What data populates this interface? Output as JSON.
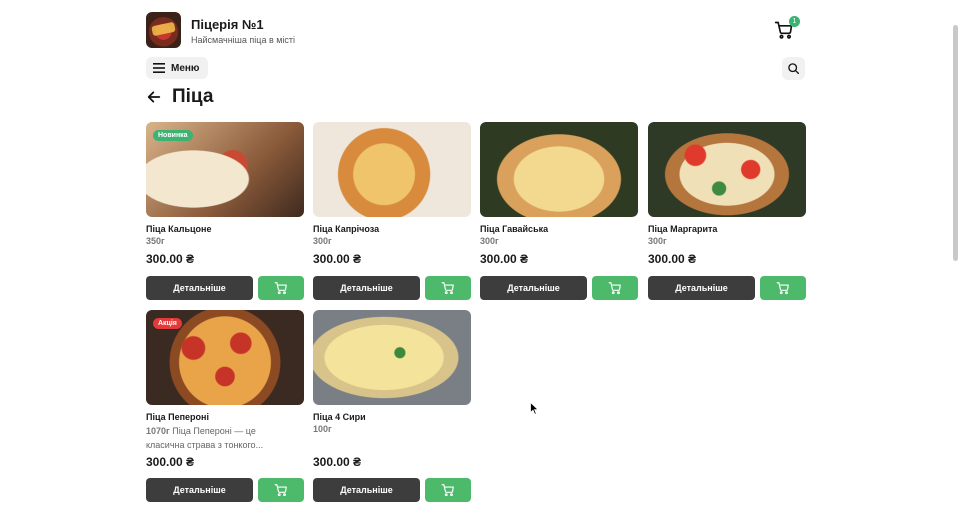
{
  "header": {
    "title": "Піцерія №1",
    "subtitle": "Найсмачніша піца в місті",
    "cart_count": "1"
  },
  "toolbar": {
    "menu_label": "Меню"
  },
  "page": {
    "title": "Піца"
  },
  "products": [
    {
      "name": "Піца Кальцоне",
      "weight": "350г",
      "desc": "",
      "price": "300.00 ₴",
      "badge": "Новинка",
      "badge_color": "#3cb371",
      "details_label": "Детальніше"
    },
    {
      "name": "Піца Капрічоза",
      "weight": "300г",
      "desc": "",
      "price": "300.00 ₴",
      "badge": "",
      "badge_color": "",
      "details_label": "Детальніше"
    },
    {
      "name": "Піца Гавайська",
      "weight": "300г",
      "desc": "",
      "price": "300.00 ₴",
      "badge": "",
      "badge_color": "",
      "details_label": "Детальніше"
    },
    {
      "name": "Піца Маргарита",
      "weight": "300г",
      "desc": "",
      "price": "300.00 ₴",
      "badge": "",
      "badge_color": "",
      "details_label": "Детальніше"
    },
    {
      "name": "Піца Пепероні",
      "weight": "1070г",
      "desc": "Піца Пепероні — це класична страва з тонкого...",
      "price": "300.00 ₴",
      "badge": "Акція",
      "badge_color": "#e23b3b",
      "details_label": "Детальніше"
    },
    {
      "name": "Піца 4 Сири",
      "weight": "100г",
      "desc": "",
      "price": "300.00 ₴",
      "badge": "",
      "badge_color": "",
      "details_label": "Детальніше"
    }
  ],
  "icons": {
    "logo": "pizzeria-logo",
    "cart": "cart-icon",
    "menu": "hamburger-menu-icon",
    "search": "search-icon",
    "back": "back-arrow-icon"
  },
  "colors": {
    "accent_green": "#4cb96b",
    "dark_button": "#3d3d3d",
    "sale_red": "#e23b3b"
  }
}
